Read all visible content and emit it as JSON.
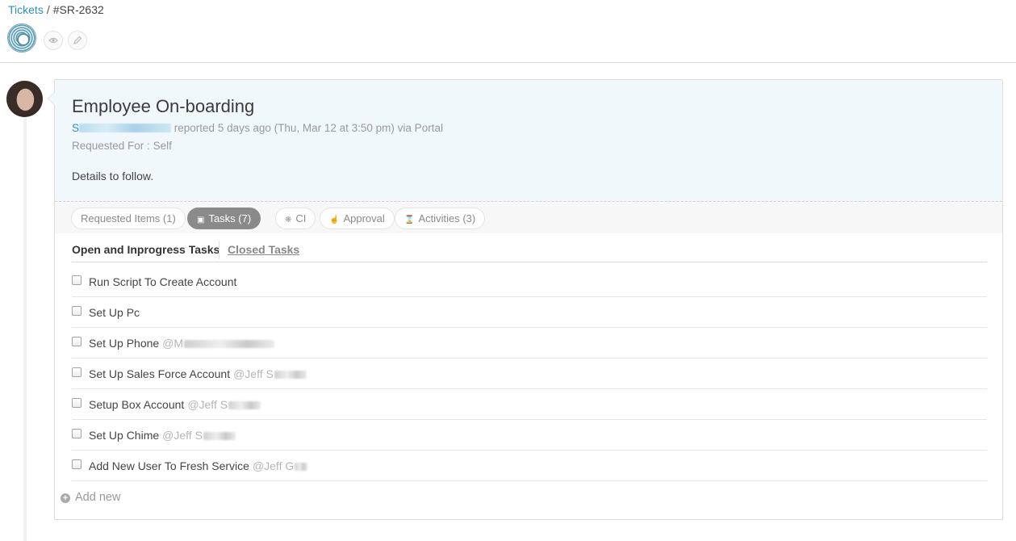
{
  "breadcrumb": {
    "root": "Tickets",
    "separator": "/",
    "current": "#SR-2632"
  },
  "toolbar": {
    "watch_icon": "eye-icon",
    "edit_icon": "pen-icon"
  },
  "ticket": {
    "title": "Employee On-boarding",
    "reporter_initial": "S",
    "reported_text": "reported 5 days ago (Thu, Mar 12 at 3:50 pm) via Portal",
    "requested_for_label": "Requested For :",
    "requested_for_value": "Self",
    "details": "Details to follow."
  },
  "tabs": [
    {
      "label": "Requested Items (1)",
      "icon": ""
    },
    {
      "label": "Tasks (7)",
      "icon": "clipboard-icon"
    },
    {
      "label": "CI",
      "icon": "cube-icon"
    },
    {
      "label": "Approval",
      "icon": "thumbs-up-icon"
    },
    {
      "label": "Activities (3)",
      "icon": "hourglass-icon"
    }
  ],
  "active_tab_index": 1,
  "task_filters": {
    "open": "Open and Inprogress Tasks",
    "closed": "Closed Tasks"
  },
  "tasks": [
    {
      "name": "Run Script To Create Account",
      "assignee": ""
    },
    {
      "name": "Set Up Pc",
      "assignee": ""
    },
    {
      "name": "Set Up Phone",
      "assignee": "@M"
    },
    {
      "name": "Set Up Sales Force Account",
      "assignee": "@Jeff S"
    },
    {
      "name": "Setup Box Account",
      "assignee": "@Jeff S"
    },
    {
      "name": "Set Up Chime",
      "assignee": "@Jeff S"
    },
    {
      "name": "Add New User To Fresh Service",
      "assignee": "@Jeff G"
    }
  ],
  "add_new_label": "Add new",
  "colors": {
    "link": "#2a8fc1",
    "card_header_bg": "#f1f8fc",
    "active_tab_bg": "#8a8a8a"
  }
}
